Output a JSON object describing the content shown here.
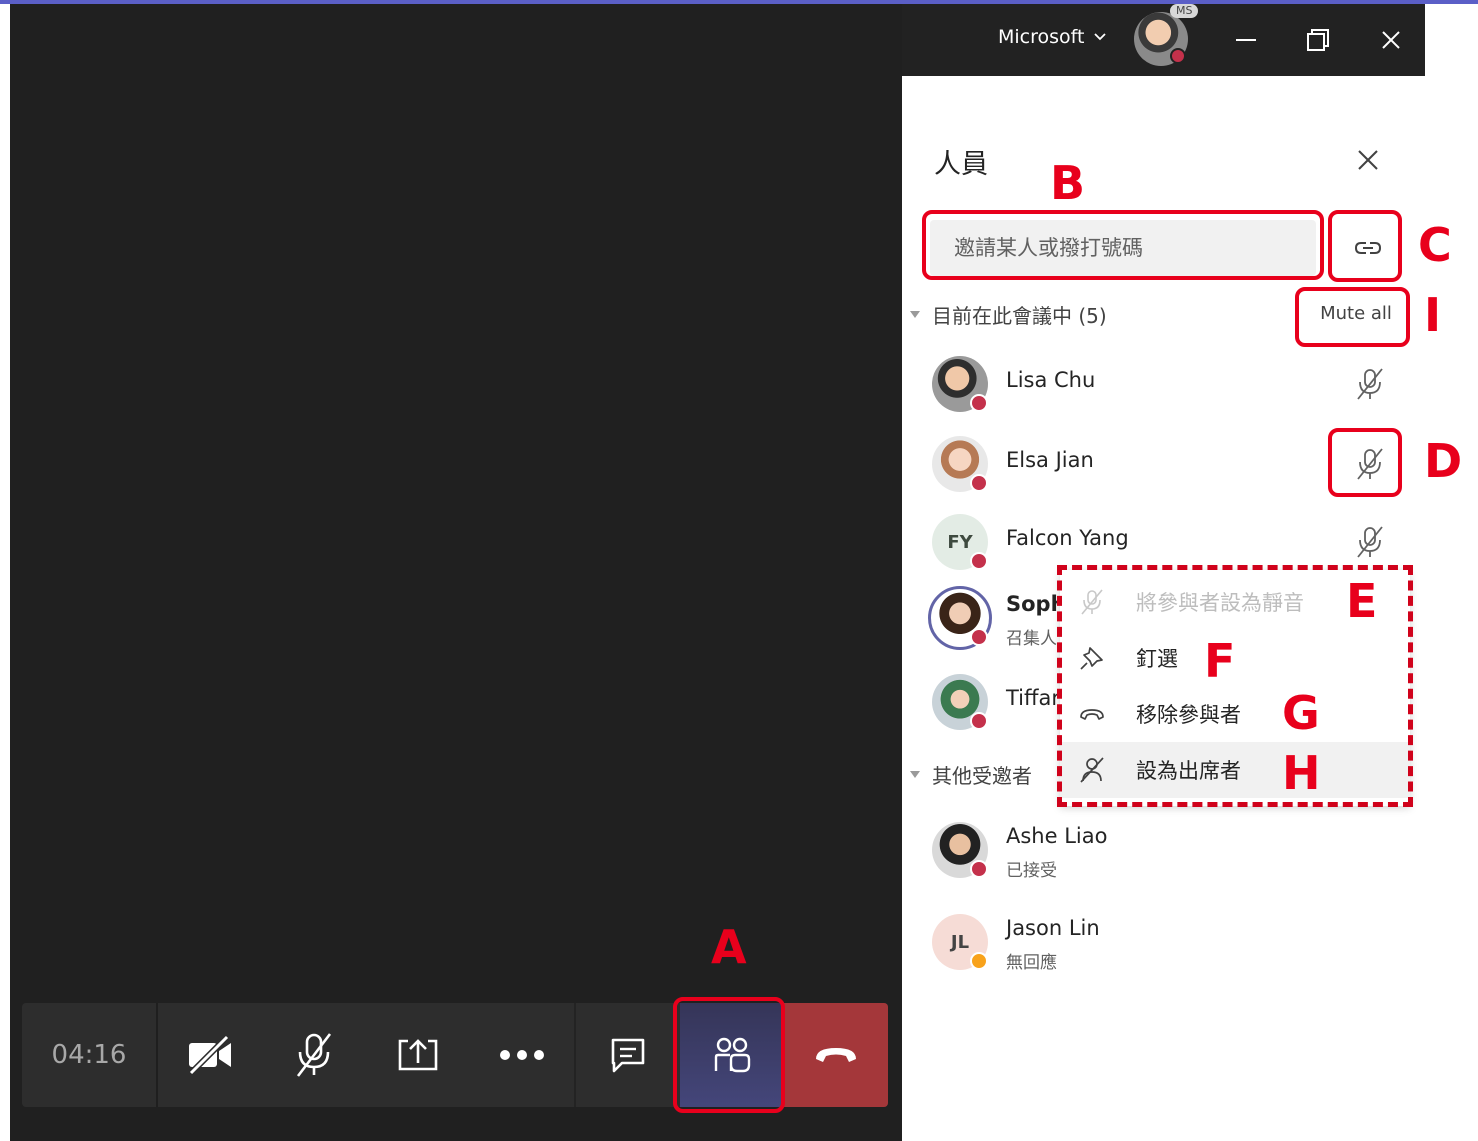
{
  "window": {
    "tenant": "Microsoft",
    "account_badge": "MS"
  },
  "call_bar": {
    "timer": "04:16"
  },
  "people_panel": {
    "title": "人員",
    "invite_placeholder": "邀請某人或撥打號碼",
    "in_meeting_header": "目前在此會議中 (5)",
    "mute_all_label": "Mute all",
    "others_header": "其他受邀者",
    "in_meeting": [
      {
        "name": "Lisa Chu",
        "subtitle": "",
        "avatar": "photo"
      },
      {
        "name": "Elsa Jian",
        "subtitle": "",
        "avatar": "photo"
      },
      {
        "name": "Falcon Yang",
        "subtitle": "",
        "avatar": "initials",
        "initials": "FY"
      },
      {
        "name": "Soph",
        "subtitle": "召集人",
        "avatar": "photo"
      },
      {
        "name": "Tiffar",
        "subtitle": "",
        "avatar": "photo"
      }
    ],
    "invited": [
      {
        "name": "Ashe Liao",
        "subtitle": "已接受",
        "avatar": "photo"
      },
      {
        "name": "Jason Lin",
        "subtitle": "無回應",
        "avatar": "initials",
        "initials": "JL"
      }
    ]
  },
  "context_menu": {
    "items": [
      {
        "label": "將參與者設為靜音",
        "icon": "mic-off-icon",
        "disabled": true
      },
      {
        "label": "釘選",
        "icon": "pin-icon",
        "disabled": false
      },
      {
        "label": "移除參與者",
        "icon": "hang-up-icon",
        "disabled": false
      },
      {
        "label": "設為出席者",
        "icon": "attendee-icon",
        "disabled": false
      }
    ]
  },
  "annotations": {
    "A": "A",
    "B": "B",
    "C": "C",
    "D": "D",
    "E": "E",
    "F": "F",
    "G": "G",
    "H": "H",
    "I": "I"
  },
  "colors": {
    "annotation_red": "#e8001c",
    "hangup_red": "#a4373a",
    "presence_busy": "#c4314b",
    "presence_away": "#f8a21b",
    "stage_dark": "#202020"
  }
}
